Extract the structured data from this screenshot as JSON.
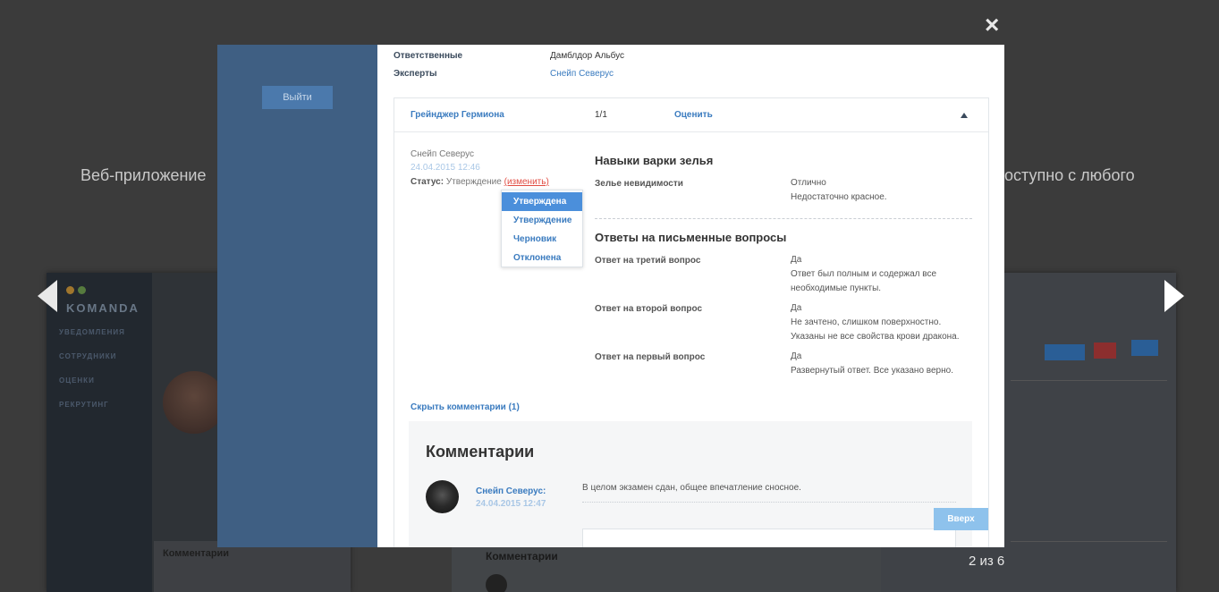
{
  "background": {
    "tagline_left": "Веб-приложение",
    "tagline_right": "оступно с любого",
    "left_shot": {
      "logo": "KOMANDA",
      "menu": [
        "УВЕДОМЛЕНИЯ",
        "СОТРУДНИКИ",
        "ОЦЕНКИ",
        "РЕКРУТИНГ"
      ],
      "comments_title": "Комментарии"
    },
    "middle_shot": {
      "comments_title": "Комментарии"
    }
  },
  "lightbox": {
    "close_label": "×",
    "counter": "2 из 6"
  },
  "app": {
    "logout_label": "Выйти",
    "meta": {
      "responsible_label": "Ответственные",
      "responsible_value": "Дамблдор Альбус",
      "experts_label": "Эксперты",
      "experts_value": "Снейп Северус"
    },
    "candidate": {
      "name": "Грейнджер Гермиона",
      "score": "1/1",
      "rate_label": "Оценить"
    },
    "review": {
      "author": "Снейп Северус",
      "date": "24.04.2015 12:46",
      "status_label": "Статус:",
      "status_value": "Утверждение",
      "change_label": "(изменить)"
    },
    "status_options": [
      "Утверждена",
      "Утверждение",
      "Черновик",
      "Отклонена"
    ],
    "status_selected": "Утверждена",
    "skills": {
      "title": "Навыки варки зелья",
      "items": [
        {
          "question": "Зелье невидимости",
          "grade": "Отлично",
          "comment": "Недостаточно красное."
        }
      ]
    },
    "written": {
      "title": "Ответы на письменные вопросы",
      "items": [
        {
          "question": "Ответ на третий вопрос",
          "grade": "Да",
          "comment_lines": [
            "Ответ был полным и содержал все",
            "необходимые пункты."
          ]
        },
        {
          "question": "Ответ на второй вопрос",
          "grade": "Да",
          "comment_lines": [
            "Не зачтено, слишком поверхностно.",
            "Указаны не все свойства крови дракона."
          ]
        },
        {
          "question": "Ответ на первый вопрос",
          "grade": "Да",
          "comment_lines": [
            "Развернутый ответ. Все указано верно."
          ]
        }
      ]
    },
    "hide_comments_label": "Скрыть комментарии (1)",
    "comments": {
      "title": "Комментарии",
      "items": [
        {
          "author": "Снейп Северус:",
          "date": "24.04.2015 12:47",
          "text": "В целом экзамен сдан, общее впечатление сносное."
        }
      ]
    },
    "up_label": "Вверх"
  }
}
